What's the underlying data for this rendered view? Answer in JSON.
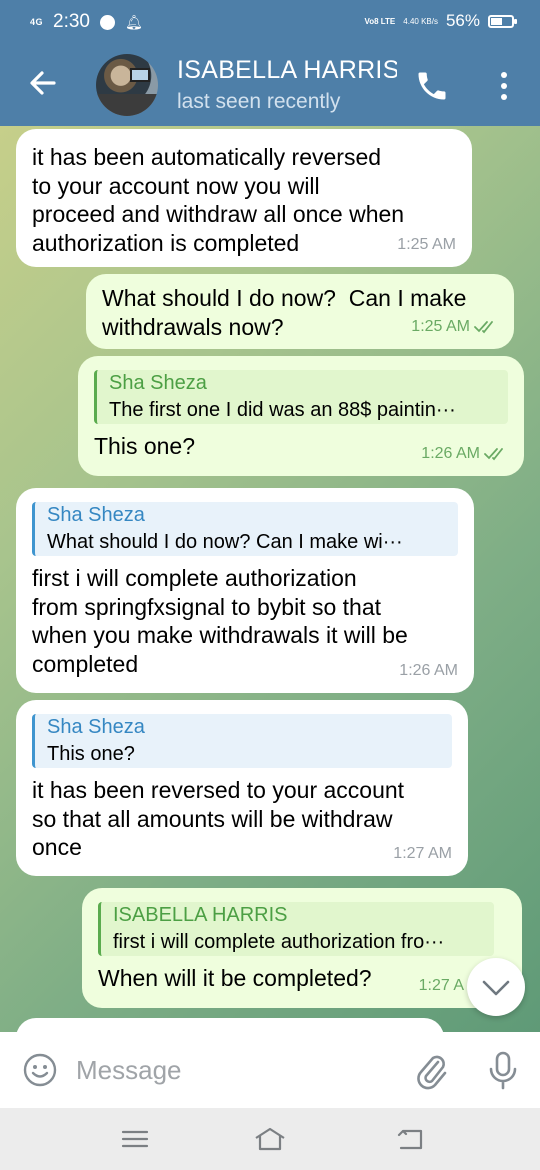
{
  "status_bar": {
    "network": "4G",
    "time": "2:30",
    "volte": "Vo8 LTE",
    "speed": "4.40 KB/s",
    "battery_percent_text": "56%",
    "battery_level": 0.56
  },
  "header": {
    "contact_name": "ISABELLA HARRIS",
    "last_seen": "last seen recently"
  },
  "messages": [
    {
      "direction": "in",
      "text": "it has been automatically reversed\nto your account now you will\nproceed and withdraw all once when\nauthorization is completed",
      "time": "1:25 AM"
    },
    {
      "direction": "out",
      "text": "What should I do now?  Can I make\nwithdrawals now?",
      "time": "1:25 AM",
      "read": true
    },
    {
      "direction": "out",
      "reply_to": {
        "name": "Sha Sheza",
        "text": "The first one I did was an 88$ paintin···"
      },
      "text": "This one?",
      "time": "1:26 AM",
      "read": true
    },
    {
      "direction": "in",
      "reply_to": {
        "name": "Sha Sheza",
        "text": "What should I do now?  Can I make wi···"
      },
      "text": "first i will complete authorization\nfrom springfxsignal to bybit so that\nwhen you make withdrawals it will be\ncompleted",
      "time": "1:26 AM"
    },
    {
      "direction": "in",
      "reply_to": {
        "name": "Sha Sheza",
        "text": "This one?"
      },
      "text": "it has been reversed to your account\nso that all amounts will be withdraw\nonce",
      "time": "1:27 AM"
    },
    {
      "direction": "out",
      "reply_to": {
        "name": "ISABELLA HARRIS",
        "text": "first i will complete authorization fro···"
      },
      "text": "When will it be completed?",
      "time": "1:27 A"
    }
  ],
  "input": {
    "placeholder": "Message",
    "value": ""
  },
  "colors": {
    "header": "#4e7fa8",
    "incoming_bubble": "#ffffff",
    "outgoing_bubble": "#effedd",
    "read_ticks": "#6aaa64"
  }
}
